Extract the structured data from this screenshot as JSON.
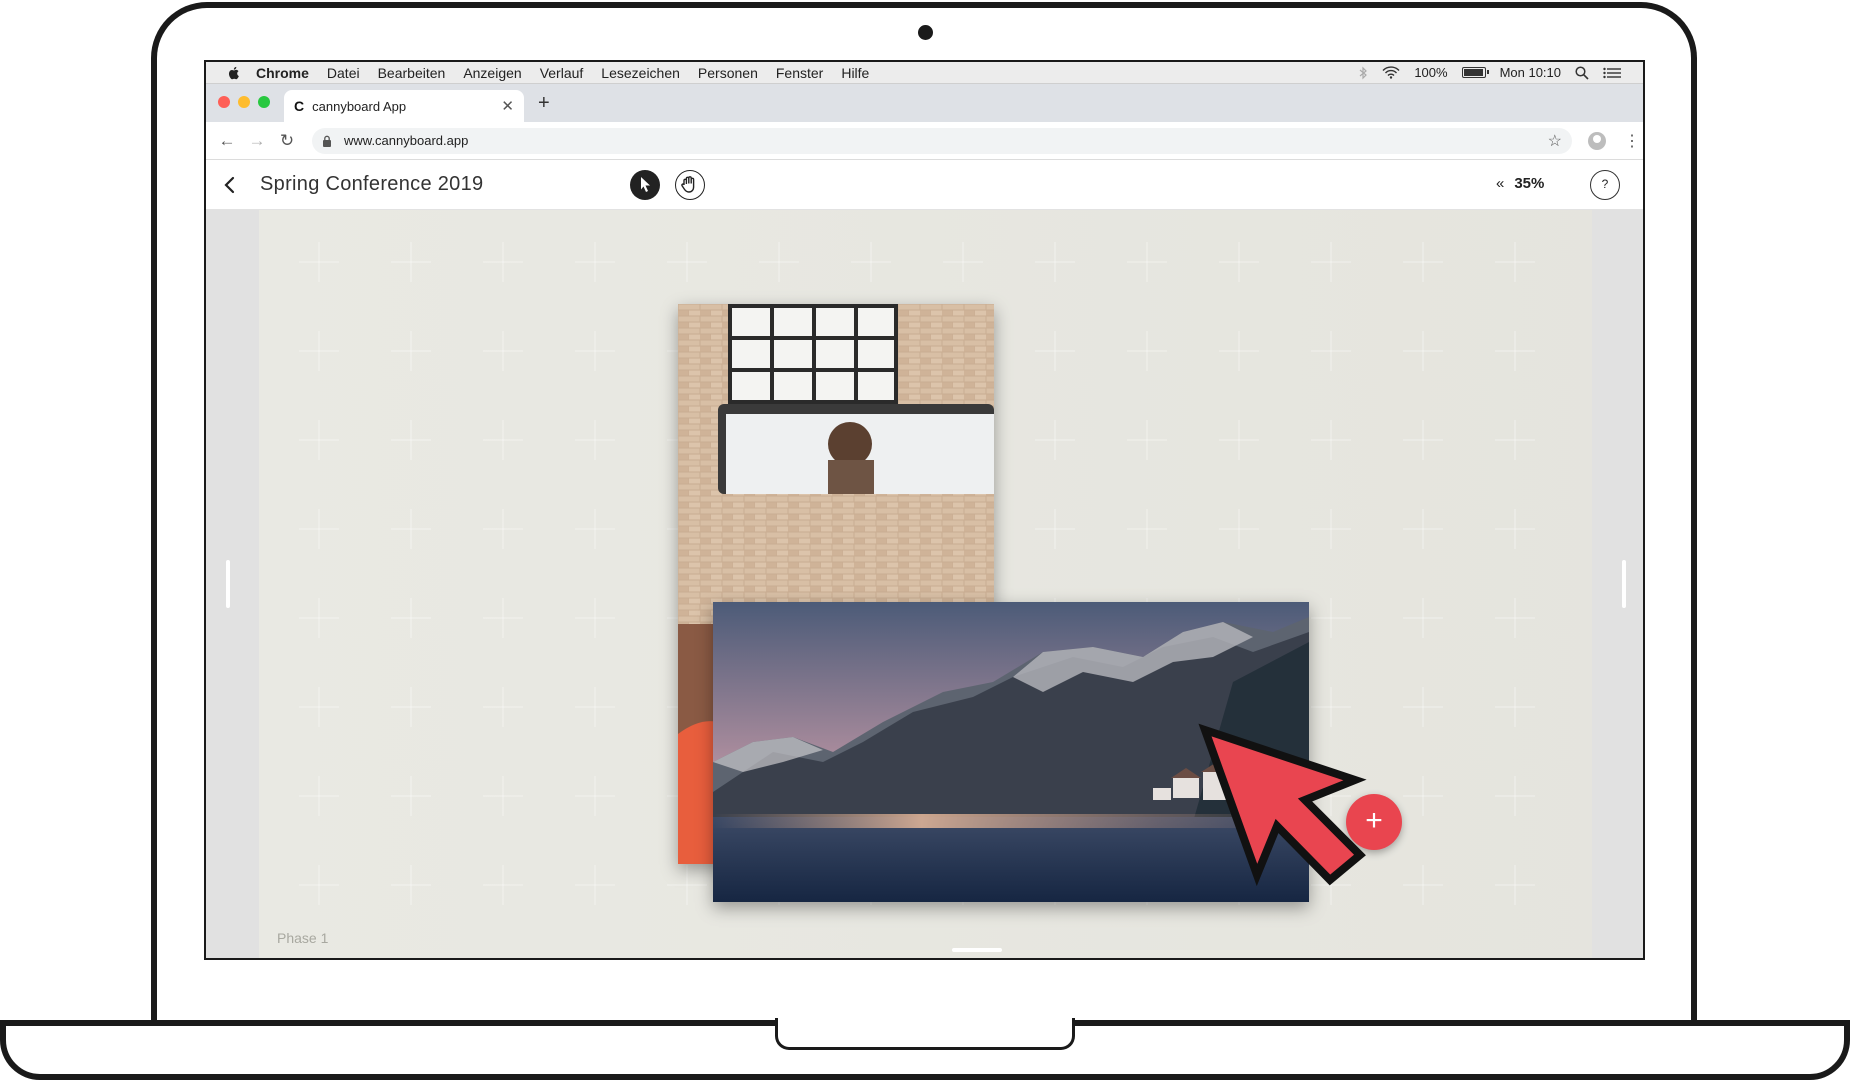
{
  "menubar": {
    "app_name": "Chrome",
    "items": [
      "Datei",
      "Bearbeiten",
      "Anzeigen",
      "Verlauf",
      "Lesezeichen",
      "Personen",
      "Fenster",
      "Hilfe"
    ],
    "battery": "100%",
    "clock": "Mon 10:10"
  },
  "browser": {
    "tab_title": "cannyboard App",
    "tab_favicon": "C",
    "url": "www.cannyboard.app"
  },
  "app": {
    "board_title": "Spring Conference 2019",
    "zoom": "35%",
    "zoom_chevron": "«",
    "help_label": "?",
    "phase_label": "Phase 1",
    "add_label": "+"
  },
  "colors": {
    "accent": "#e9454f",
    "board": "#d6d5cb",
    "cursor": "#e94550"
  }
}
